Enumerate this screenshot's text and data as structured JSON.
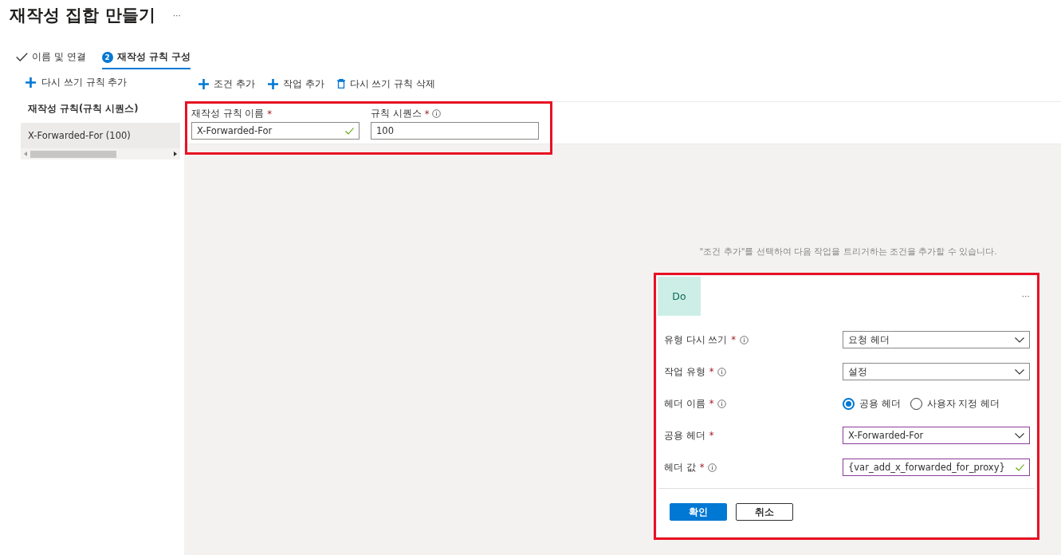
{
  "title": "재작성 집합 만들기",
  "title_more": "···",
  "tabs": [
    {
      "label": "이름 및 연결",
      "kind": "done",
      "selected": false
    },
    {
      "label": "재작성 규칙 구성",
      "kind": "step",
      "step": "2",
      "selected": true
    }
  ],
  "sidebar": {
    "add_label": "다시 쓰기 규칙 추가",
    "heading": "재작성 규칙(규칙 시퀀스)",
    "rules": [
      {
        "label": "X-Forwarded-For (100)",
        "selected": true
      }
    ]
  },
  "toolbar": [
    {
      "kind": "add",
      "label": "조건 추가"
    },
    {
      "kind": "add",
      "label": "작업 추가"
    },
    {
      "kind": "delete",
      "label": "다시 쓰기 규칙 삭제"
    }
  ],
  "rule_form": {
    "name_label": "재작성 규칙 이름",
    "required_mark": "*",
    "name_value": "X-Forwarded-For",
    "name_valid": true,
    "sequence_label": "규칙 시퀀스",
    "sequence_required_mark": "*",
    "sequence_value": "100"
  },
  "hint": "\"조건 추가\"를 선택하여 다음 작업을 트리거하는 조건을 추가할 수 있습니다.",
  "action_card": {
    "badge": "Do",
    "more": "···",
    "fields": [
      {
        "label": "유형 다시 쓰기",
        "required_mark": "*",
        "info": true,
        "kind": "select",
        "value": "요청 헤더",
        "focused": false
      },
      {
        "label": "작업 유형",
        "required_mark": "*",
        "info": true,
        "kind": "select",
        "value": "설정",
        "focused": false
      },
      {
        "label": "헤더 이름",
        "required_mark": "*",
        "info": true,
        "kind": "radio",
        "options": [
          {
            "label": "공용 헤더",
            "selected": true
          },
          {
            "label": "사용자 지정 헤더",
            "selected": false
          }
        ]
      },
      {
        "label": "공용 헤더",
        "required_mark": "*",
        "info": false,
        "kind": "select",
        "value": "X-Forwarded-For",
        "focused": true
      },
      {
        "label": "헤더 값",
        "required_mark": "*",
        "info": true,
        "kind": "input",
        "value": "{var_add_x_forwarded_for_proxy}",
        "valid": true,
        "focused": true
      }
    ],
    "buttons": [
      {
        "label": "확인",
        "kind": "primary"
      },
      {
        "label": "취소",
        "kind": "secondary"
      }
    ]
  }
}
